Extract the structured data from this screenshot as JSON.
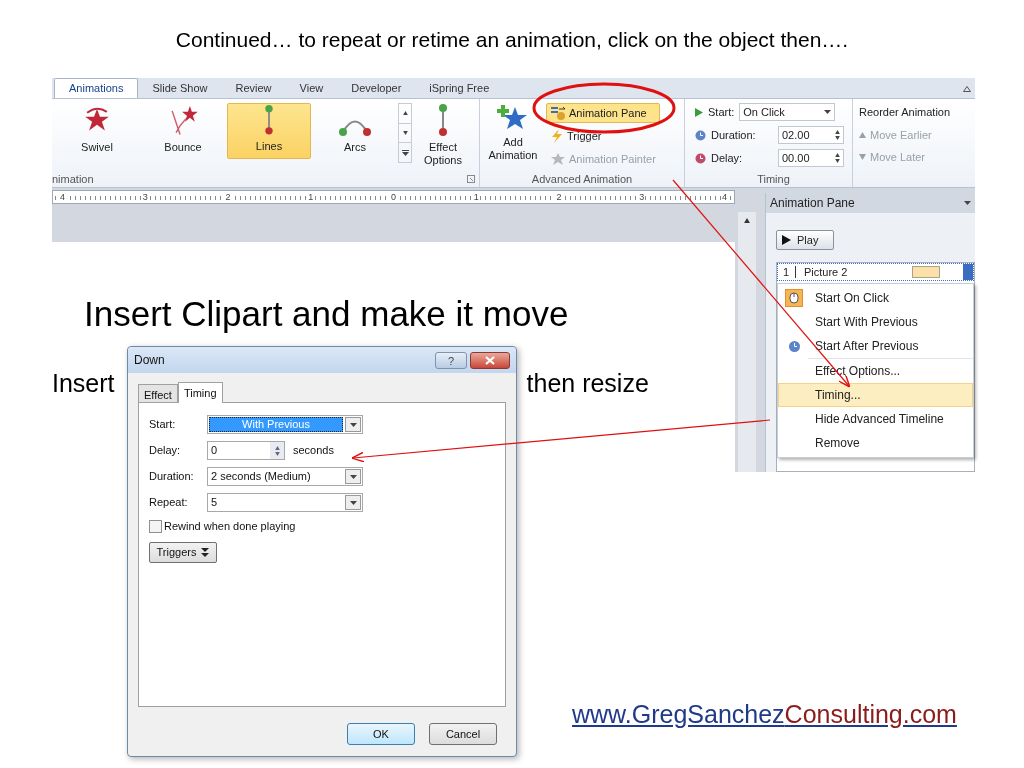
{
  "slide_title": "Continued… to repeat or retime an animation, click on the object then….",
  "ribbon": {
    "tabs": [
      {
        "label": "Animations",
        "selected": true
      },
      {
        "label": "Slide Show",
        "selected": false
      },
      {
        "label": "Review",
        "selected": false
      },
      {
        "label": "View",
        "selected": false
      },
      {
        "label": "Developer",
        "selected": false
      },
      {
        "label": "iSpring Free",
        "selected": false
      }
    ],
    "gallery": [
      {
        "label": "Swivel",
        "kind": "swivel",
        "selected": false
      },
      {
        "label": "Bounce",
        "kind": "bounce",
        "selected": false
      },
      {
        "label": "Lines",
        "kind": "lines",
        "selected": true
      },
      {
        "label": "Arcs",
        "kind": "arcs",
        "selected": false
      }
    ],
    "effect_options": "Effect Options",
    "animation_group": "nimation",
    "add_animation": "Add Animation",
    "advanced": [
      {
        "label": "Animation Pane",
        "kind": "pane",
        "selected": true,
        "disabled": false
      },
      {
        "label": "Trigger",
        "kind": "trigger",
        "selected": false,
        "disabled": false
      },
      {
        "label": "Animation Painter",
        "kind": "painter",
        "selected": false,
        "disabled": true
      }
    ],
    "advanced_group": "Advanced Animation",
    "timing": {
      "start_label": "Start:",
      "start_value": "On Click",
      "duration_label": "Duration:",
      "duration_value": "02.00",
      "delay_label": "Delay:",
      "delay_value": "00.00",
      "group": "Timing"
    },
    "reorder": {
      "title": "Reorder Animation",
      "move_earlier": "Move Earlier",
      "move_later": "Move Later"
    }
  },
  "ruler": [
    "4",
    "3",
    "2",
    "1",
    "0",
    "1",
    "2",
    "3",
    "4"
  ],
  "slide": {
    "title": "Insert Clipart and make it move",
    "line_start": "Insert",
    "line_end": "then resize"
  },
  "animation_pane": {
    "title": "Animation Pane",
    "play": "Play",
    "item": {
      "number": "1",
      "name": "Picture 2"
    },
    "menu": [
      {
        "label": "Start On Click",
        "kind": "click",
        "checked": true,
        "selected": false
      },
      {
        "label": "Start With Previous",
        "kind": "with",
        "checked": false,
        "selected": false
      },
      {
        "label": "Start After Previous",
        "kind": "after",
        "checked": false,
        "selected": false
      },
      {
        "label": "Effect Options...",
        "kind": "command",
        "checked": false,
        "selected": false
      },
      {
        "label": "Timing...",
        "kind": "command",
        "checked": false,
        "selected": true
      },
      {
        "label": "Hide Advanced Timeline",
        "kind": "command",
        "checked": false,
        "selected": false
      },
      {
        "label": "Remove",
        "kind": "command",
        "checked": false,
        "selected": false
      }
    ]
  },
  "dialog": {
    "title": "Down",
    "help": "?",
    "tabs": [
      {
        "label": "Effect",
        "selected": false
      },
      {
        "label": "Timing",
        "selected": true
      }
    ],
    "fields": [
      {
        "label": "Start:",
        "value": "With Previous",
        "kind": "dropdown",
        "selected": true
      },
      {
        "label": "Delay:",
        "value": "0",
        "kind": "spinner",
        "unit": "seconds",
        "selected": false
      },
      {
        "label": "Duration:",
        "value": "2 seconds (Medium)",
        "kind": "dropdown",
        "selected": false
      },
      {
        "label": "Repeat:",
        "value": "5",
        "kind": "dropdown",
        "selected": false
      }
    ],
    "rewind": {
      "label": "Rewind when done playing",
      "checked": false
    },
    "triggers": "Triggers",
    "ok": "OK",
    "cancel": "Cancel"
  },
  "footer_link": [
    {
      "text": "www.GregSanchez",
      "color": "#1f3a8a"
    },
    {
      "text": "Consulting.com",
      "color": "#8b1c1c"
    }
  ]
}
